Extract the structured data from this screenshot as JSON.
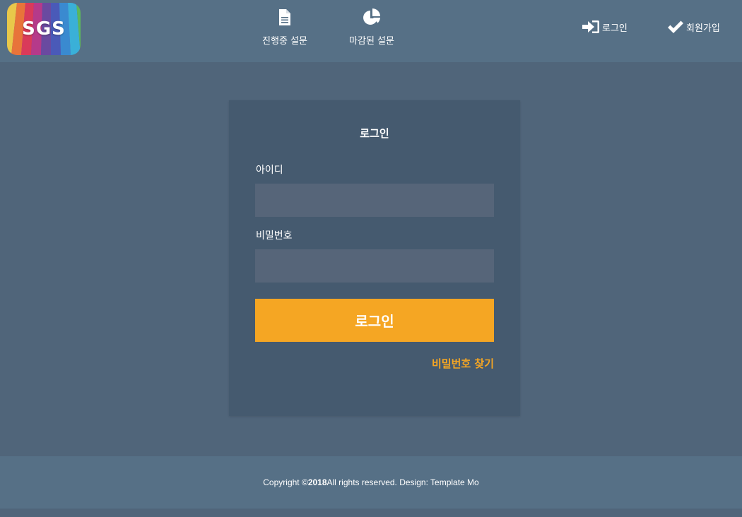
{
  "logo": {
    "text": "SGS"
  },
  "nav": {
    "ongoing_label": "진행중 설문",
    "closed_label": "마감된 설문"
  },
  "top_links": {
    "login_label": "로그인",
    "signup_label": "회원가입"
  },
  "login_card": {
    "title": "로그인",
    "id_label": "아이디",
    "id_value": "",
    "pw_label": "비밀번호",
    "pw_value": "",
    "submit_label": "로그인",
    "find_password_label": "비밀번호 찾기"
  },
  "footer": {
    "prefix": "Copyright © ",
    "year": "2018",
    "suffix": " All rights reserved. Design: Template Mo"
  },
  "colors": {
    "header_bg": "#567086",
    "page_bg": "#50657a",
    "card_bg": "#455a6f",
    "input_bg": "#566579",
    "accent": "#f5a623"
  },
  "icons": {
    "ongoing": "document-icon",
    "closed": "pie-chart-icon",
    "login": "sign-in-icon",
    "signup": "checkmark-icon"
  }
}
